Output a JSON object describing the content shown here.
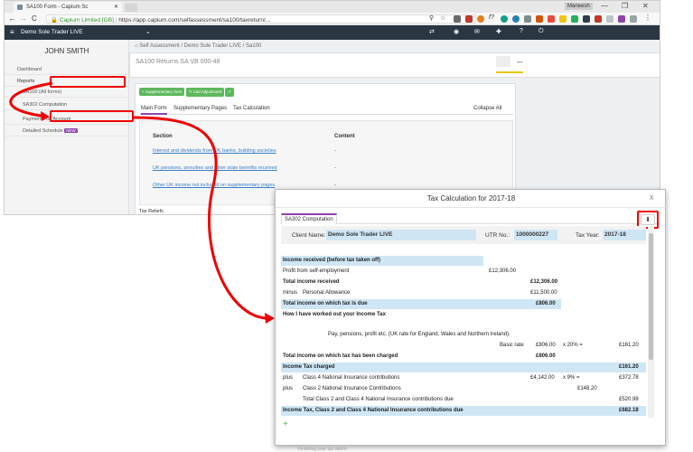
{
  "browser": {
    "tab_title": "SA100 Form - Capium Sc",
    "profile": "Maneesh",
    "min": "—",
    "max": "❐",
    "close": "✕",
    "nav_back": "←",
    "nav_fwd": "→",
    "nav_reload": "C",
    "secure_label": "Capium Limited [GB]",
    "url": "https://app.capium.com/selfassessment/sa100/taxreturn/..."
  },
  "app": {
    "company": "Demo Sole Trader LIVE",
    "user": "JOHN SMITH",
    "breadcrumb": "Self Assessment / Demo Sole Trader LIVE / Sa100",
    "page_title": "SA100 Returns SA VB 000-48",
    "sidebar": {
      "dashboard": "Dashboard",
      "reports": "Reports",
      "items": [
        "SA100 (All forms)",
        "SA302 Computation",
        "Payments on Account",
        "Detailed Schedule"
      ],
      "badge": "NEW"
    },
    "toolbar": {
      "supplementary": "+ Supplementary form",
      "add_adjustment": "✎ Add Adjustment"
    },
    "tabs": [
      "Main Form",
      "Supplementary Pages",
      "Tax Calculation"
    ],
    "collapse_all": "Collapse All",
    "table_header": [
      "Section",
      "Content"
    ],
    "table_rows": [
      {
        "section": "Interest and dividends from UK banks, building societies",
        "content": "-"
      },
      {
        "section": "UK pensions, annuities and other state benefits received",
        "content": "-"
      },
      {
        "section": "Other UK income not included on supplementary pages",
        "content": "-"
      }
    ],
    "tax_reliefs": "Tax Reliefs"
  },
  "modal": {
    "title": "Tax Calculation for 2017-18",
    "close": "x",
    "tab": "SA302 Computation",
    "client_label": "Client Name:",
    "client_value": "Demo Sole Trader LIVE",
    "utr_label": "UTR No.:",
    "utr_value": "1000000227",
    "year_label": "Tax Year:",
    "year_value": "2017-18",
    "rows": {
      "income_received": "Income received (before tax taken off)",
      "profit_label": "Profit from self-employment",
      "profit_value": "£12,306.00",
      "total_income_label": "Total income received",
      "total_income_value": "£12,306.00",
      "minus": "minus",
      "allowance_label": "Personal Allowance",
      "allowance_value": "£11,500.00",
      "taxdue_label": "Total income on which tax is due",
      "taxdue_value": "£806.00",
      "worked_out": "How I have worked out your Income Tax",
      "pay_label": "Pay, pensions, profit etc. (UK rate for England, Wales and Northern Ireland).",
      "basic_label": "Basic rate",
      "basic_amount": "£806.00",
      "basic_rate": "x 20% =",
      "basic_value": "£161.20",
      "charged_income_label": "Total income on which tax has been charged",
      "charged_income_value": "£806.00",
      "income_tax_label": "Income Tax charged",
      "income_tax_value": "£161.20",
      "plus": "plus",
      "class4_label": "Class 4 National Insurance contributions",
      "class4_amount": "£4,142.00",
      "class4_rate": "x 9% =",
      "class4_value": "£372.78",
      "class2_label": "Class 2 National Insurance Contributions",
      "class2_value": "£148.20",
      "total_ni_label": "Total Class 2 and Class 4 National Insurance contributions due",
      "total_ni_value": "£520.98",
      "grand_label": "Income Tax, Class 2 and Class 4 National Insurance contributions due",
      "grand_value": "£682.18"
    },
    "add": "+",
    "behind_text": "Finishing your tax return"
  },
  "colors": {
    "accent": "#e00000",
    "nav": "#2b3643",
    "highlight": "#cfe6f5",
    "purple": "#8e44ad"
  }
}
